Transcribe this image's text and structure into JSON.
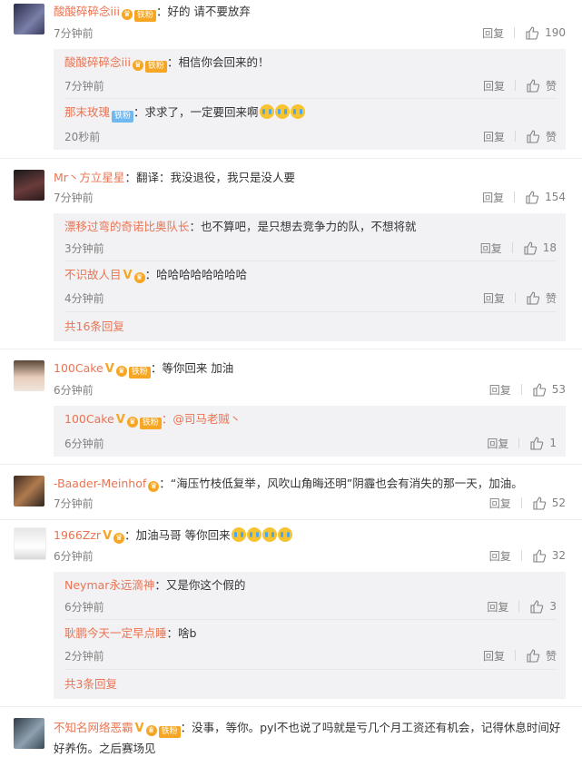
{
  "actions": {
    "reply": "回复",
    "like": "赞"
  },
  "comments": [
    {
      "name": "酸酸碎碎念iii",
      "badge": "铁粉",
      "text": "：好的 请不要放弃",
      "time": "7分钟前",
      "likes": "190",
      "replies": [
        {
          "name": "酸酸碎碎念iii",
          "badge": "铁粉",
          "text": "：相信你会回来的！",
          "time": "7分钟前",
          "likes": "赞"
        },
        {
          "name": "那末玫瑰",
          "badge": "铁粉",
          "text": "：求求了，一定要回来啊",
          "time": "20秒前",
          "likes": "赞"
        }
      ]
    },
    {
      "name": "Mr丶方立星星",
      "text": "：翻译：我没退役，我只是没人要",
      "time": "7分钟前",
      "likes": "154",
      "replies": [
        {
          "name": "漂移过弯的奇诺比奥队长",
          "text": "：也不算吧，是只想去竞争力的队，不想将就",
          "time": "3分钟前",
          "likes": "18"
        },
        {
          "name": "不识故人目",
          "text": "：哈哈哈哈哈哈哈哈",
          "time": "4分钟前",
          "likes": "赞"
        }
      ],
      "more": "共16条回复"
    },
    {
      "name": "100Cake",
      "badge": "铁粉",
      "text": "：等你回来 加油",
      "time": "6分钟前",
      "likes": "53",
      "replies": [
        {
          "name": "100Cake",
          "badge": "铁粉",
          "text": "：@司马老贼丶",
          "time": "6分钟前",
          "likes": "1"
        }
      ]
    },
    {
      "name": "-Baader-Meinhof",
      "text": "：“海压竹枝低复举，风吹山角晦还明”阴霾也会有消失的那一天，加油。",
      "time": "7分钟前",
      "likes": "52"
    },
    {
      "name": "1966Zzr",
      "text": "：加油马哥 等你回来",
      "time": "6分钟前",
      "likes": "32",
      "replies": [
        {
          "name": "Neymar永远滴神",
          "text": "：又是你这个假的",
          "time": "6分钟前",
          "likes": "3"
        },
        {
          "name": "耿鹏今天一定早点睡",
          "text": "：啥b",
          "time": "2分钟前",
          "likes": "赞"
        }
      ],
      "more": "共3条回复"
    },
    {
      "name": "不知名网络恶霸",
      "badge": "铁粉",
      "text": "：没事，等你。pyl不也说了吗就是亏几个月工资还有机会，记得休息时间好好养伤。之后赛场见"
    }
  ]
}
